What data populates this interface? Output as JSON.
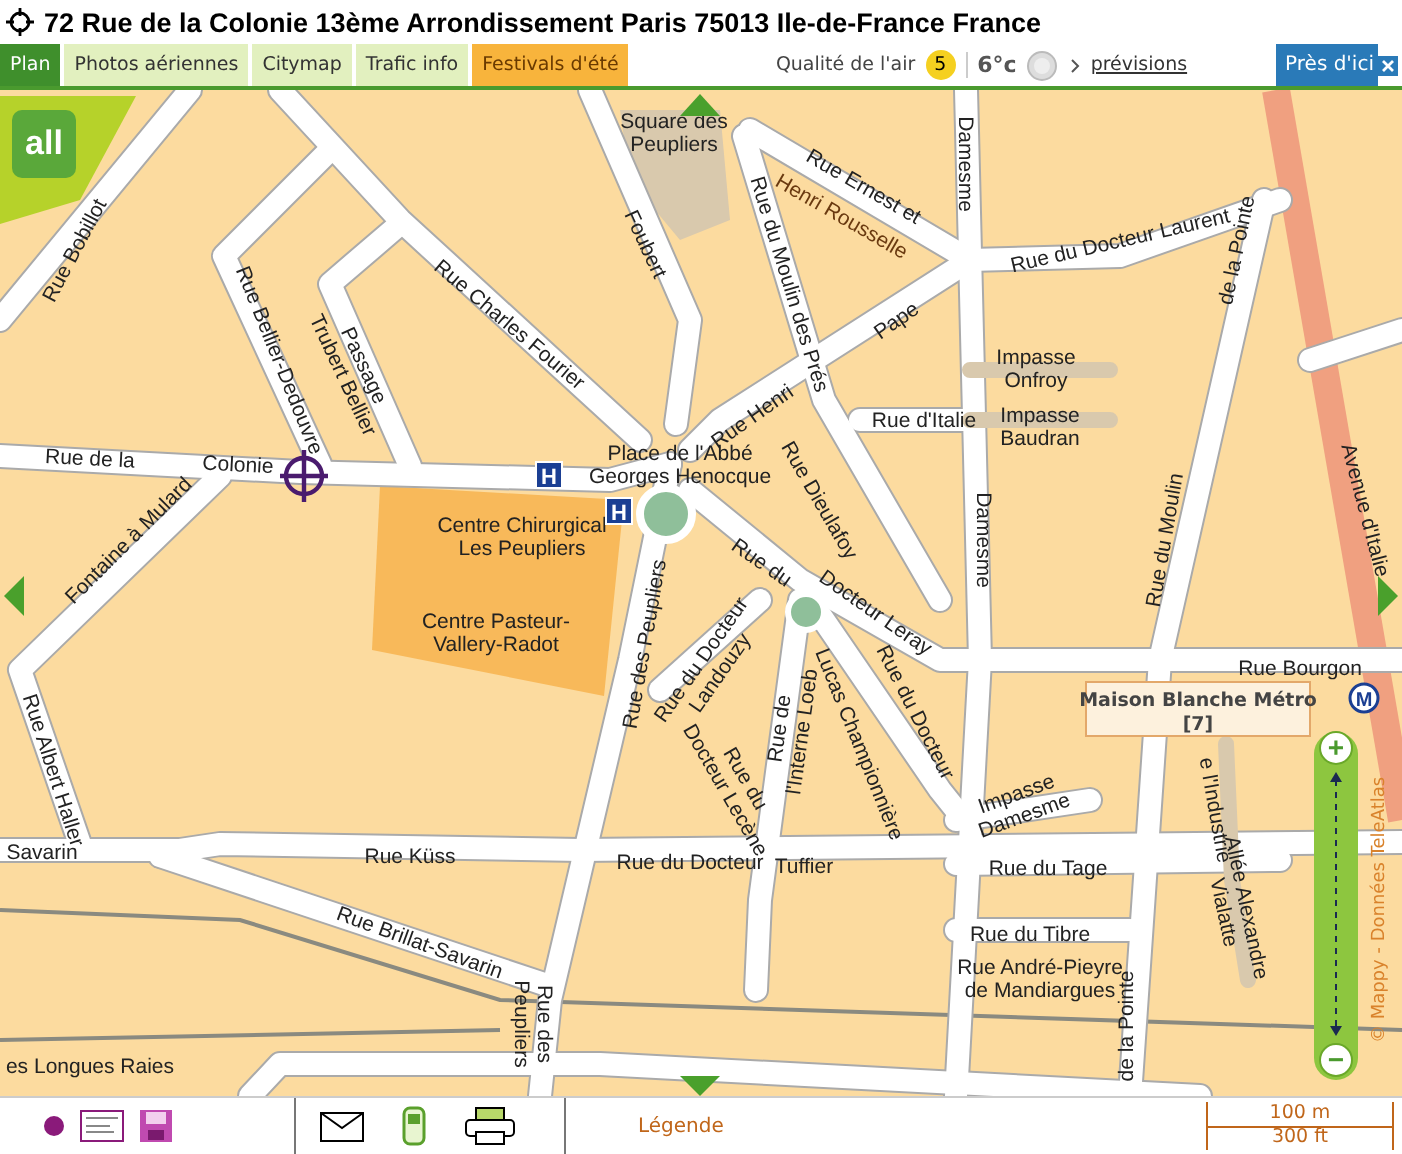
{
  "title": "72 Rue de la Colonie 13ème Arrondissement Paris 75013 Ile-de-France France",
  "tabs": [
    {
      "label": "Plan",
      "selected": true,
      "kind": "view"
    },
    {
      "label": "Photos aériennes",
      "selected": false,
      "kind": "view"
    },
    {
      "label": "Citymap",
      "selected": false,
      "kind": "view"
    },
    {
      "label": "Trafic info",
      "selected": false,
      "kind": "view"
    },
    {
      "label": "Festivals d'été",
      "selected": false,
      "kind": "event"
    }
  ],
  "air_quality": {
    "label": "Qualité de l'air",
    "index": "5"
  },
  "temperature": "6°c",
  "forecast_link": "prévisions",
  "nearby_button": "Près d'ici",
  "map": {
    "logo": "all",
    "labels": [
      {
        "lines": [
          "Square des",
          "Peupliers"
        ]
      },
      {
        "lines": [
          "Foubert"
        ]
      },
      {
        "lines": [
          "Rue Ernest et"
        ]
      },
      {
        "lines": [
          "Henri Rousselle"
        ]
      },
      {
        "lines": [
          "Rue du Moulin des Prés"
        ]
      },
      {
        "lines": [
          "Rue du Docteur Laurent"
        ]
      },
      {
        "lines": [
          "Damesme"
        ]
      },
      {
        "lines": [
          "Pape"
        ]
      },
      {
        "lines": [
          "Impasse",
          "Onfroy"
        ]
      },
      {
        "lines": [
          "Rue d'Italie"
        ]
      },
      {
        "lines": [
          "Impasse",
          "Baudran"
        ]
      },
      {
        "lines": [
          "de la Pointe"
        ]
      },
      {
        "lines": [
          "Avenue d'Italie"
        ]
      },
      {
        "lines": [
          "Rue Bobillot"
        ]
      },
      {
        "lines": [
          "Rue Bellier-Dedouvre"
        ]
      },
      {
        "lines": [
          "Passage",
          "Trubert Bellier"
        ]
      },
      {
        "lines": [
          "Rue Charles Fourier"
        ]
      },
      {
        "lines": [
          "Rue de la"
        ]
      },
      {
        "lines": [
          "Colonie"
        ]
      },
      {
        "lines": [
          "Place de l'Abbé",
          "Georges Henocque"
        ]
      },
      {
        "lines": [
          "Rue Henri"
        ]
      },
      {
        "lines": [
          "Rue Dieulafoy"
        ]
      },
      {
        "lines": [
          "Damesme"
        ]
      },
      {
        "lines": [
          "Rue du Moulin"
        ]
      },
      {
        "lines": [
          "Fontaine à Mulard"
        ]
      },
      {
        "lines": [
          "Centre Chirurgical",
          "Les Peupliers"
        ]
      },
      {
        "lines": [
          "Centre Pasteur-",
          "Vallery-Radot"
        ]
      },
      {
        "lines": [
          "Rue des Peupliers"
        ]
      },
      {
        "lines": [
          "Rue du"
        ]
      },
      {
        "lines": [
          "Docteur Leray"
        ]
      },
      {
        "lines": [
          "Rue du Docteur",
          "Landouzy"
        ]
      },
      {
        "lines": [
          "Rue de",
          "l'Interne Loeb"
        ]
      },
      {
        "lines": [
          "Lucas Championnière"
        ]
      },
      {
        "lines": [
          "Rue du Docteur"
        ]
      },
      {
        "lines": [
          "Rue du",
          "Docteur Lecène"
        ]
      },
      {
        "lines": [
          "Rue Albert Haller"
        ]
      },
      {
        "lines": [
          "Savarin"
        ]
      },
      {
        "lines": [
          "Rue Küss"
        ]
      },
      {
        "lines": [
          "Rue du Docteur"
        ]
      },
      {
        "lines": [
          "Tuffier"
        ]
      },
      {
        "lines": [
          "Impasse",
          "Damesme"
        ]
      },
      {
        "lines": [
          "Rue du Tage"
        ]
      },
      {
        "lines": [
          "e l'Industrie"
        ]
      },
      {
        "lines": [
          "Allée Alexandre",
          "Vialatte"
        ]
      },
      {
        "lines": [
          "Rue du Tibre"
        ]
      },
      {
        "lines": [
          "Rue André-Pieyre",
          "de Mandiargues"
        ]
      },
      {
        "lines": [
          "Rue Brillat-Savarin"
        ]
      },
      {
        "lines": [
          "Rue des",
          "Peupliers"
        ]
      },
      {
        "lines": [
          "de la Pointe"
        ]
      },
      {
        "lines": [
          "Rue Bourgon"
        ]
      },
      {
        "lines": [
          "es Longues Raies"
        ]
      }
    ],
    "hospital_markers": [
      {
        "symbol": "H"
      },
      {
        "symbol": "H"
      }
    ],
    "metro_station": {
      "name": "Maison Blanche Métro",
      "line": "[7]",
      "symbol": "M"
    },
    "copyright": "© Mappy - Données TeleAtlas",
    "zoom": {
      "in": "+",
      "out": "−"
    }
  },
  "legend_link": "Légende",
  "scale": {
    "metric": "100 m",
    "imperial": "300 ft"
  }
}
